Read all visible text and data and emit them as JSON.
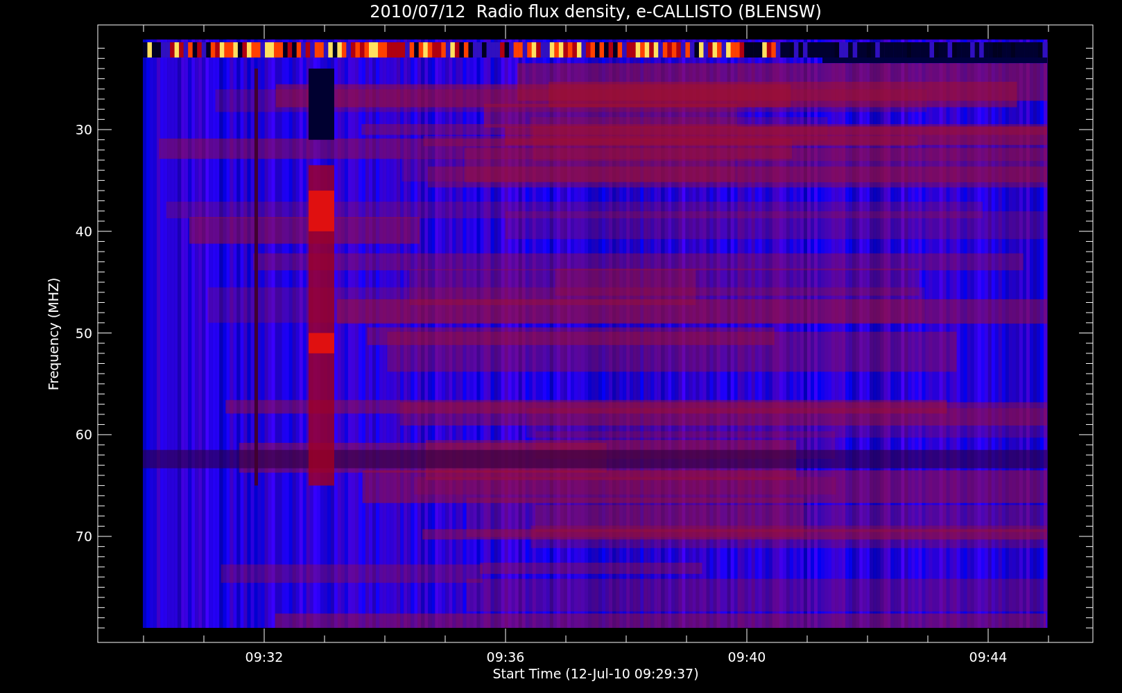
{
  "title": "2010/07/12  Radio flux density, e-CALLISTO (BLENSW)",
  "y_axis": {
    "label": "Frequency (MHZ)",
    "ticks": [
      "30",
      "40",
      "50",
      "60",
      "70"
    ]
  },
  "x_axis": {
    "label": "Start Time (12-Jul-10 09:29:37)",
    "ticks": [
      "09:32",
      "09:36",
      "09:40",
      "09:44"
    ]
  }
}
